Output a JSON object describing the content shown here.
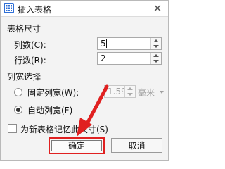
{
  "dialog": {
    "title": "插入表格",
    "icons": {
      "app": "table-icon",
      "close": "close-icon"
    },
    "close_glyph": "✕"
  },
  "table_size": {
    "section_title": "表格尺寸",
    "columns": {
      "label": "列数(C):",
      "value": "5"
    },
    "rows": {
      "label": "行数(R):",
      "value": "2"
    }
  },
  "col_width": {
    "section_title": "列宽选择",
    "fixed": {
      "label": "固定列宽(W):",
      "selected": false,
      "value": "1.59",
      "unit": "毫米"
    },
    "auto": {
      "label": "自动列宽(F)",
      "selected": true
    }
  },
  "remember": {
    "label": "为新表格记忆此尺寸(S)",
    "checked": false
  },
  "buttons": {
    "ok": "确定",
    "cancel": "取消"
  },
  "colors": {
    "highlight": "#e02020",
    "accent": "#2f6fd6"
  }
}
